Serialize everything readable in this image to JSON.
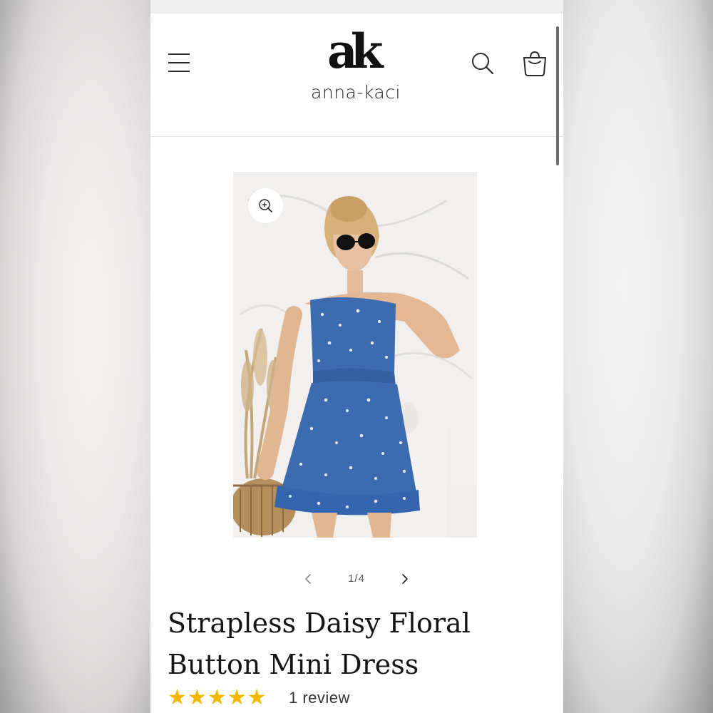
{
  "header": {
    "menu_icon": "hamburger-menu-icon",
    "logo_mark": "ak",
    "logo_text": "anna-kaci",
    "search_icon": "search-icon",
    "cart_icon": "shopping-bag-icon"
  },
  "gallery": {
    "zoom_icon": "zoom-in-icon",
    "image_alt": "",
    "dress_color": "#3c6bb0",
    "pager_text": "1/4",
    "prev_icon": "chevron-left-icon",
    "next_icon": "chevron-right-icon"
  },
  "product": {
    "title_line1": "Strapless Daisy Floral",
    "title_line2": "Button Mini Dress",
    "rating_stars": 5,
    "rating_max": 5,
    "star_color": "#f3b800",
    "review_text": "1 review"
  }
}
